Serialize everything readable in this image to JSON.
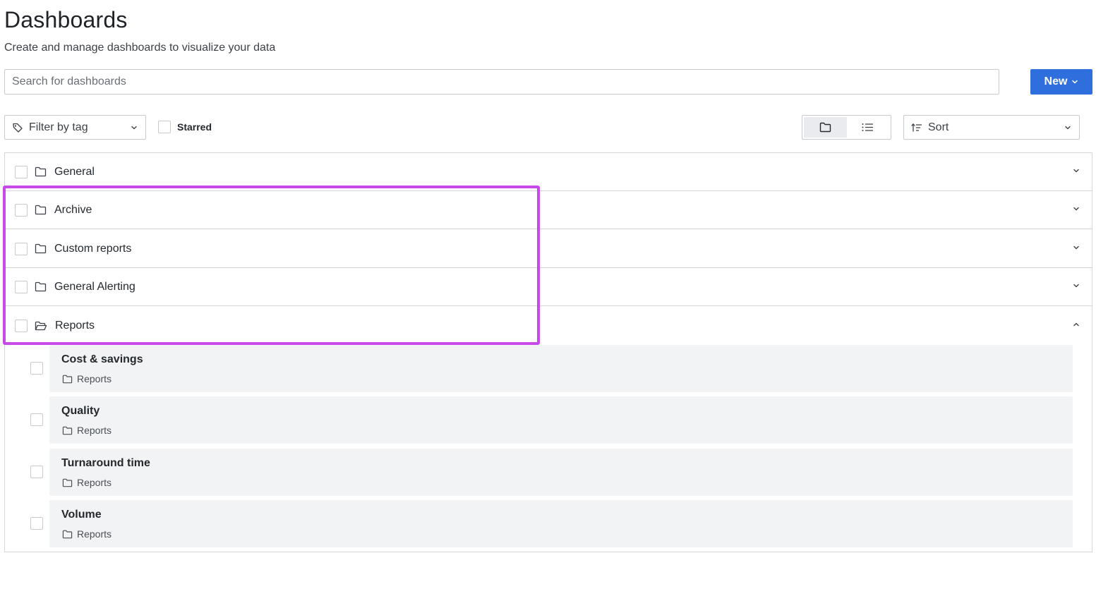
{
  "header": {
    "title": "Dashboards",
    "subtitle": "Create and manage dashboards to visualize your data"
  },
  "search": {
    "placeholder": "Search for dashboards",
    "value": ""
  },
  "new_button": {
    "label": "New",
    "color": "#2f6fdd"
  },
  "toolbar": {
    "filter_label": "Filter by tag",
    "starred_label": "Starred",
    "starred_checked": false,
    "view_mode": "folder",
    "sort_label": "Sort"
  },
  "folders": [
    {
      "name": "General",
      "expanded": false,
      "icon": "folder-icon"
    },
    {
      "name": "Archive",
      "expanded": false,
      "icon": "folder-icon"
    },
    {
      "name": "Custom reports",
      "expanded": false,
      "icon": "folder-icon"
    },
    {
      "name": "General Alerting",
      "expanded": false,
      "icon": "folder-icon"
    },
    {
      "name": "Reports",
      "expanded": true,
      "icon": "folder-open-icon"
    }
  ],
  "dashboards": [
    {
      "title": "Cost & savings",
      "folder": "Reports"
    },
    {
      "title": "Quality",
      "folder": "Reports"
    },
    {
      "title": "Turnaround time",
      "folder": "Reports"
    },
    {
      "title": "Volume",
      "folder": "Reports"
    }
  ],
  "highlight": {
    "color": "#c74ae8"
  }
}
